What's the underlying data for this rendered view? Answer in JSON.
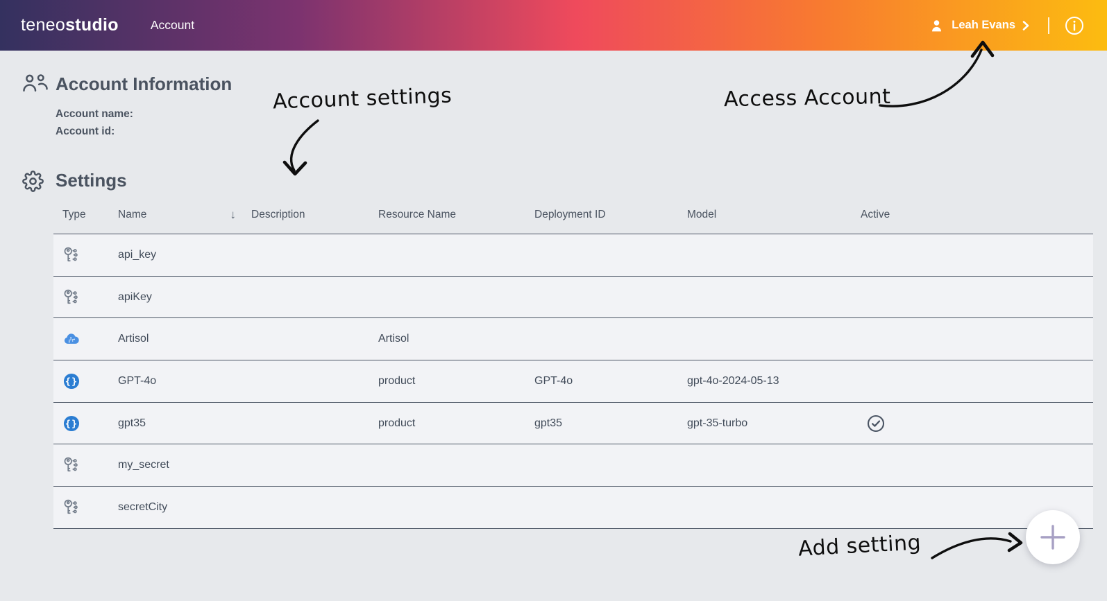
{
  "header": {
    "logo": {
      "light": "teneo",
      "bold": "studio"
    },
    "page_label": "Account",
    "user": {
      "name": "Leah Evans"
    }
  },
  "account_info": {
    "title": "Account Information",
    "name_label": "Account name:",
    "id_label": "Account id:"
  },
  "settings": {
    "title": "Settings",
    "sort_arrow": "↓",
    "columns": {
      "type": "Type",
      "name": "Name",
      "description": "Description",
      "resource_name": "Resource Name",
      "deployment_id": "Deployment ID",
      "model": "Model",
      "active": "Active"
    },
    "rows": [
      {
        "icon": "key",
        "name": "api_key",
        "description": "",
        "resource_name": "",
        "deployment_id": "",
        "model": "",
        "active": false
      },
      {
        "icon": "key",
        "name": "apiKey",
        "description": "",
        "resource_name": "",
        "deployment_id": "",
        "model": "",
        "active": false
      },
      {
        "icon": "cloud-ai",
        "name": "Artisol",
        "description": "",
        "resource_name": "Artisol",
        "deployment_id": "",
        "model": "",
        "active": false
      },
      {
        "icon": "braces",
        "name": "GPT-4o",
        "description": "",
        "resource_name": "product",
        "deployment_id": "GPT-4o",
        "model": "gpt-4o-2024-05-13",
        "active": false
      },
      {
        "icon": "braces",
        "name": "gpt35",
        "description": "",
        "resource_name": "product",
        "deployment_id": "gpt35",
        "model": "gpt-35-turbo",
        "active": true
      },
      {
        "icon": "key",
        "name": "my_secret",
        "description": "",
        "resource_name": "",
        "deployment_id": "",
        "model": "",
        "active": false
      },
      {
        "icon": "key",
        "name": "secretCity",
        "description": "",
        "resource_name": "",
        "deployment_id": "",
        "model": "",
        "active": false
      }
    ]
  },
  "annotations": {
    "account_settings": "Account settings",
    "access_account": "Access Account",
    "add_setting": "Add setting"
  },
  "icons": {
    "braces_glyph": "{}"
  },
  "colors": {
    "topbar_gradient": [
      "#34315f",
      "#7c336f",
      "#ef4a5c",
      "#f87a30",
      "#fcbc10"
    ],
    "page_bg": "#e7e9ec",
    "row_bg": "#f2f3f6",
    "row_divider": "#4a5463",
    "heading_text": "#4a5360",
    "cell_text": "#414b59",
    "type_icon_gray": "#717b89",
    "accent_blue": "#2b7dd2",
    "cloud_blue": "#4a90e2",
    "plus_purple": "#a7a0c4",
    "annotation_ink": "#0e0e0e"
  }
}
